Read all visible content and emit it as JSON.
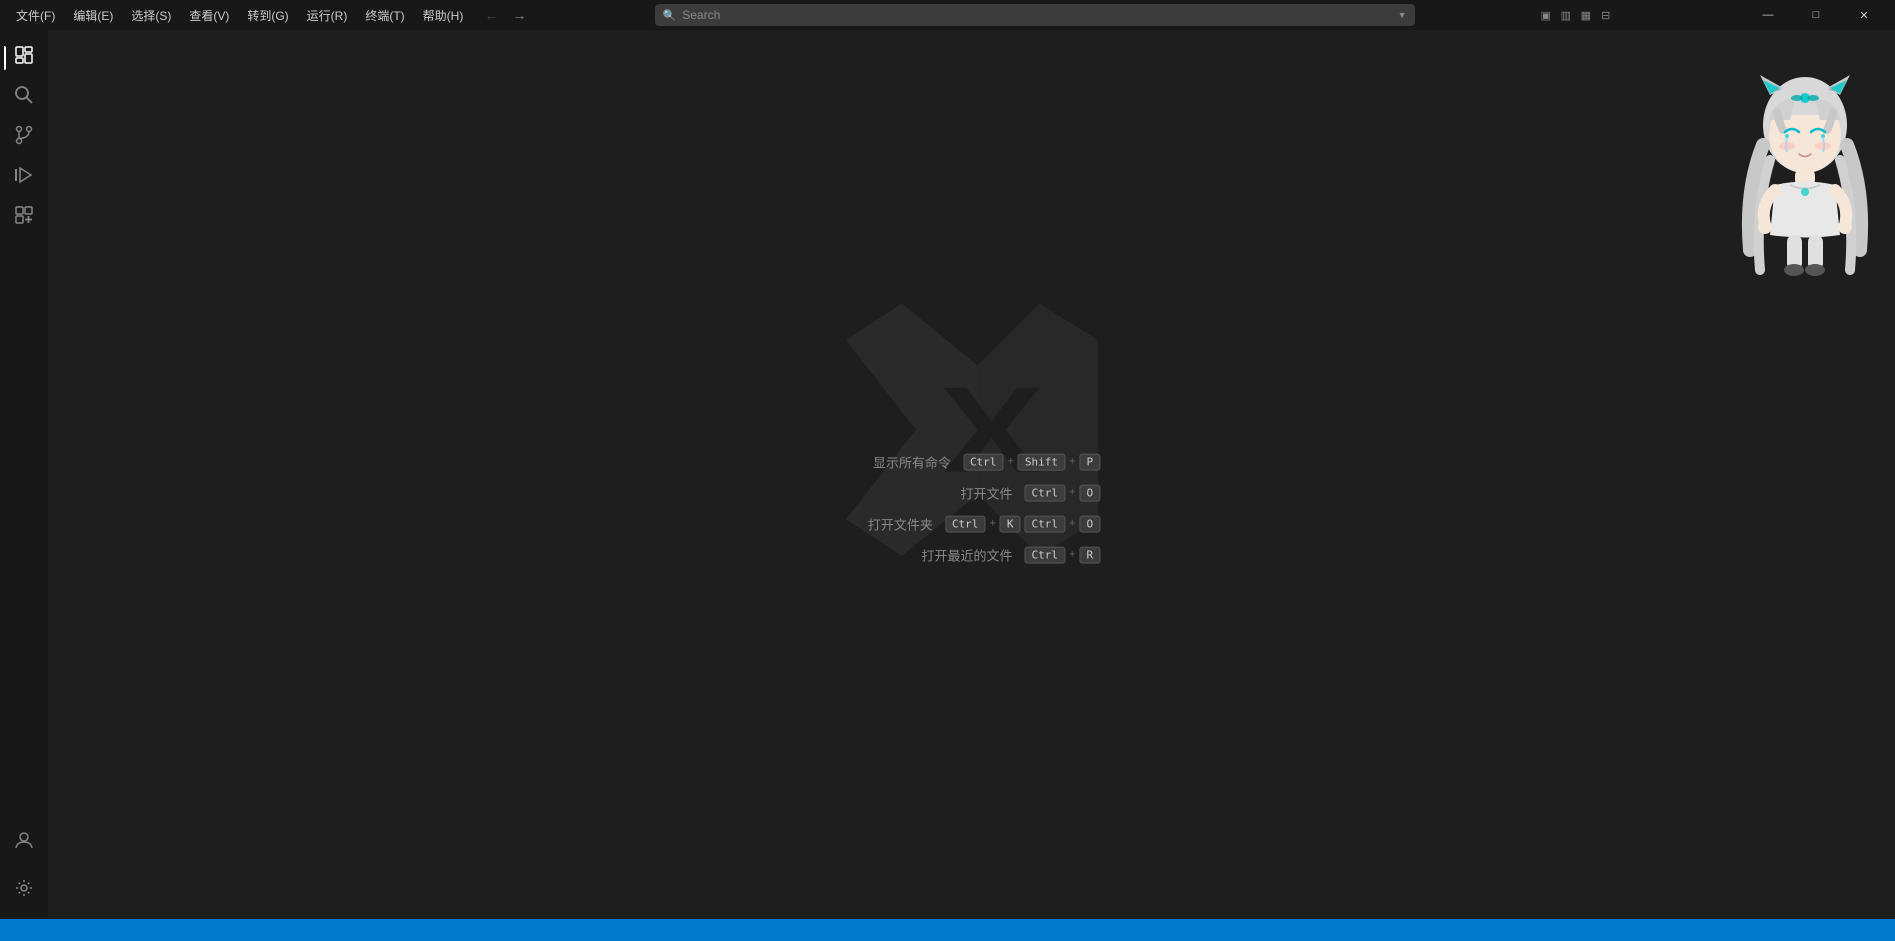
{
  "titlebar": {
    "menu_items": [
      {
        "label": "文件(F)",
        "id": "file"
      },
      {
        "label": "编辑(E)",
        "id": "edit"
      },
      {
        "label": "选择(S)",
        "id": "select"
      },
      {
        "label": "查看(V)",
        "id": "view"
      },
      {
        "label": "转到(G)",
        "id": "goto"
      },
      {
        "label": "运行(R)",
        "id": "run"
      },
      {
        "label": "终端(T)",
        "id": "terminal"
      },
      {
        "label": "帮助(H)",
        "id": "help"
      }
    ],
    "search_placeholder": "Search",
    "back_disabled": true,
    "forward_disabled": false
  },
  "activity_bar": {
    "icons": [
      {
        "name": "explorer-icon",
        "symbol": "⎘",
        "active": true,
        "title": "资源管理器"
      },
      {
        "name": "search-icon",
        "symbol": "⌕",
        "active": false,
        "title": "搜索"
      },
      {
        "name": "source-control-icon",
        "symbol": "⑂",
        "active": false,
        "title": "源代码管理"
      },
      {
        "name": "run-debug-icon",
        "symbol": "▷",
        "active": false,
        "title": "运行和调试"
      },
      {
        "name": "extensions-icon",
        "symbol": "⊞",
        "active": false,
        "title": "扩展"
      }
    ],
    "bottom_icons": [
      {
        "name": "accounts-icon",
        "symbol": "◉",
        "title": "账户"
      },
      {
        "name": "settings-icon",
        "symbol": "⚙",
        "title": "管理"
      }
    ]
  },
  "shortcuts": [
    {
      "label": "显示所有命令",
      "keys": [
        "Ctrl",
        "+",
        "Shift",
        "+",
        "P"
      ]
    },
    {
      "label": "打开文件",
      "keys": [
        "Ctrl",
        "+",
        "O"
      ]
    },
    {
      "label": "打开文件夹",
      "keys": [
        "Ctrl",
        "+",
        "K",
        "Ctrl",
        "+",
        "O"
      ]
    },
    {
      "label": "打开最近的文件",
      "keys": [
        "Ctrl",
        "+",
        "R"
      ]
    }
  ],
  "layout_icons": [
    "▣",
    "▥",
    "▦",
    "⊟"
  ],
  "window_controls": {
    "minimize": "—",
    "maximize": "□",
    "close": "✕"
  },
  "status_bar": {
    "text": ""
  }
}
